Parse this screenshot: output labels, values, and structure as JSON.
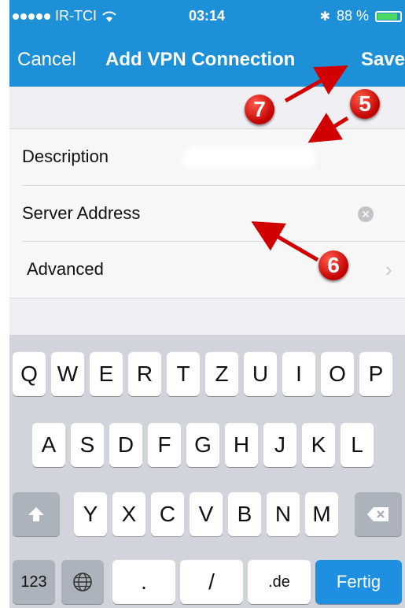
{
  "status_bar": {
    "carrier": "IR-TCI",
    "time": "03:14",
    "battery_text": "88 %",
    "battery_level": 0.88
  },
  "nav": {
    "cancel": "Cancel",
    "title": "Add VPN Connection",
    "save": "Save"
  },
  "form": {
    "description_label": "Description",
    "server_label": "Server Address",
    "advanced_label": "Advanced"
  },
  "keyboard": {
    "row1": [
      "Q",
      "W",
      "E",
      "R",
      "T",
      "Z",
      "U",
      "I",
      "O",
      "P"
    ],
    "row2": [
      "A",
      "S",
      "D",
      "F",
      "G",
      "H",
      "J",
      "K",
      "L"
    ],
    "row3": [
      "Y",
      "X",
      "C",
      "V",
      "B",
      "N",
      "M"
    ],
    "num_key": "123",
    "dot_key": ".",
    "slash_key": "/",
    "de_key": ".de",
    "done_key": "Fertig"
  },
  "annotations": [
    "7",
    "5",
    "6"
  ],
  "colors": {
    "accent": "#1e90d7",
    "done_key": "#1e8fe1",
    "marker": "#d00000"
  }
}
